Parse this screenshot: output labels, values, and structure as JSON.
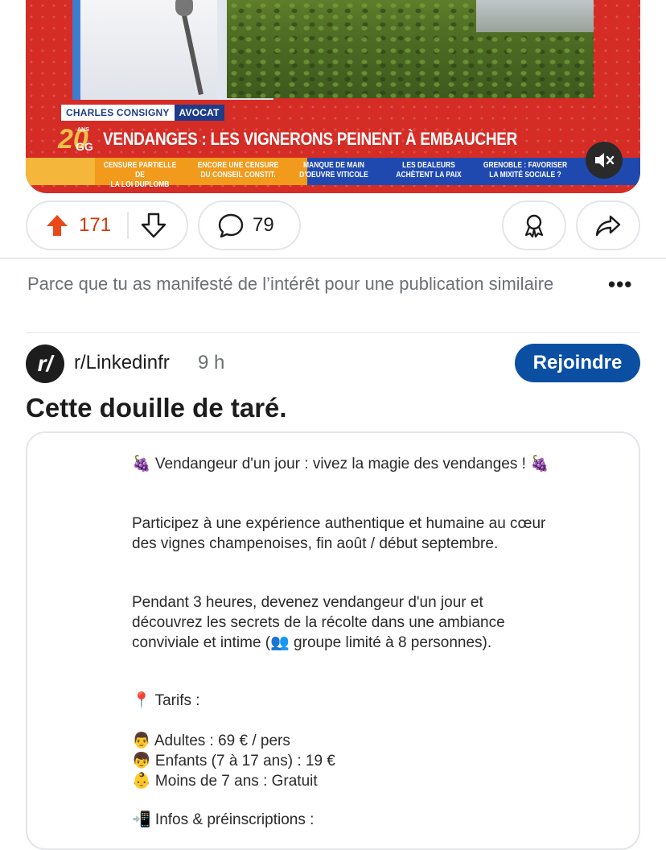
{
  "video": {
    "chyron_name": "CHARLES CONSIGNY",
    "chyron_role": "AVOCAT",
    "logo_number": "20",
    "logo_small": "ANS",
    "logo_letters": "GG",
    "headline": "VENDANGES : LES VIGNERONS PEINENT À EMBAUCHER",
    "ticker": [
      {
        "line1": "CENSURE PARTIELLE DE",
        "line2": "LA LOI DUPLOMB"
      },
      {
        "line1": "ENCORE UNE CENSURE",
        "line2": "DU CONSEIL CONSTIT."
      },
      {
        "line1": "MANQUE DE MAIN",
        "line2": "D'OEUVRE VITICOLE"
      },
      {
        "line1": "LES DEALEURS",
        "line2": "ACHÈTENT LA PAIX"
      },
      {
        "line1": "GRENOBLE : FAVORISER",
        "line2": "LA MIXITÉ SOCIALE ?"
      }
    ],
    "mute_icon": "speaker-muted-icon"
  },
  "actions": {
    "upvotes": "171",
    "comments": "79",
    "upvote_color": "#cf3a0b"
  },
  "reason": {
    "text": "Parce que tu as manifesté de l’intérêt pour une publication similaire",
    "more": "•••"
  },
  "post": {
    "avatar_text": "r/",
    "subreddit": "r/Linkedinfr",
    "time": "9 h",
    "join_label": "Rejoindre",
    "join_color": "#0b4fa3",
    "title": "Cette douille de taré.",
    "image_text": {
      "p1": "🍇 Vendangeur d'un jour : vivez la magie des vendanges ! 🍇",
      "p2": "Participez à une expérience authentique et humaine au cœur des vignes champenoises, fin août / début septembre.",
      "p3": "Pendant 3 heures, devenez vendangeur d'un jour et découvrez les secrets de la récolte dans une ambiance conviviale et intime (👥 groupe limité à 8 personnes).",
      "tarifs": "📍 Tarifs :",
      "adultes": "👨 Adultes : 69 € / pers",
      "enfants": "👦 Enfants (7 à 17 ans) : 19 €",
      "moins": "👶 Moins de 7 ans : Gratuit",
      "infos": "📲 Infos & préinscriptions :"
    }
  }
}
